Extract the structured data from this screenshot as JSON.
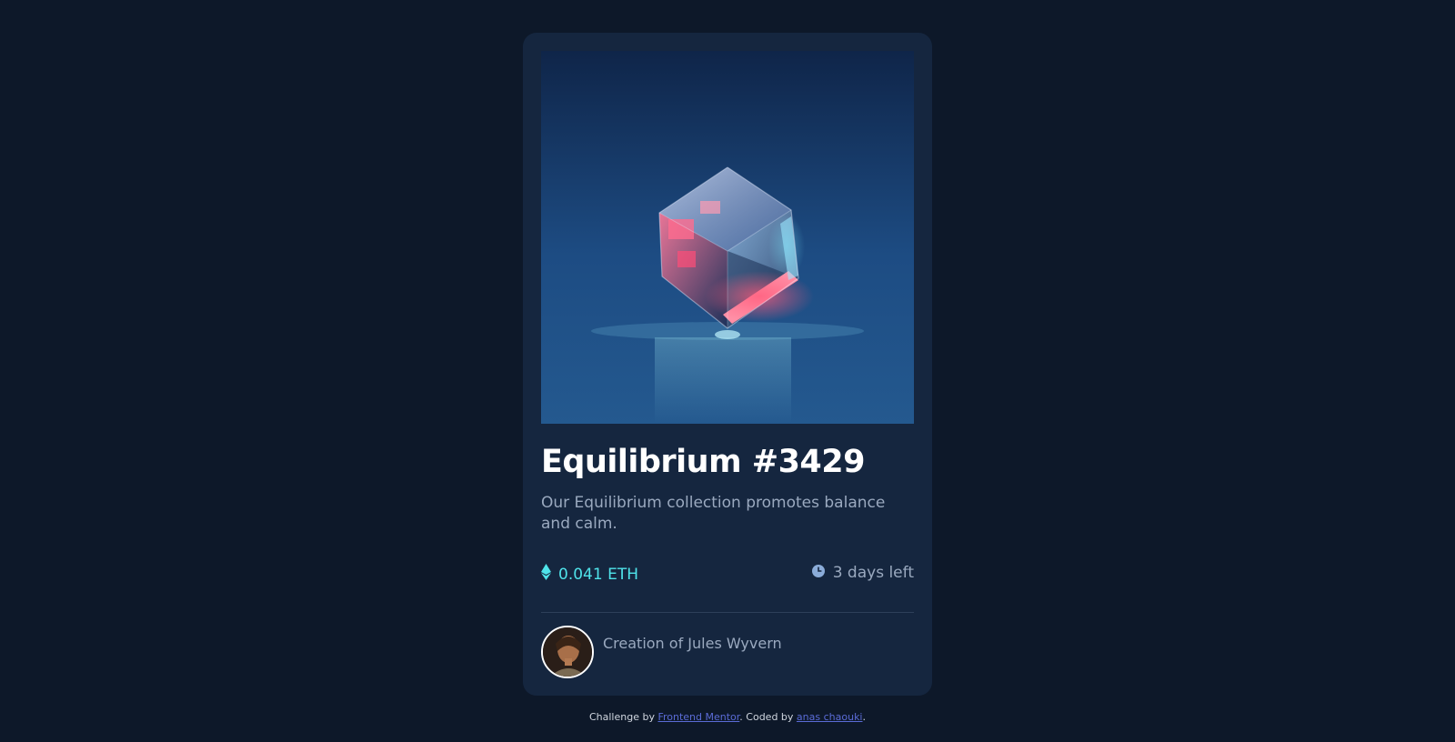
{
  "card": {
    "title": "Equilibrium #3429",
    "description": "Our Equilibrium collection promotes balance and calm.",
    "price": "0.041 ETH",
    "time_left": "3 days left",
    "creator_prefix": "Creation of",
    "creator_name": "Jules Wyvern",
    "hero_image": "equilibrium-cube-image",
    "avatar_image": "jules-wyvern-avatar"
  },
  "icons": {
    "price": "ethereum-icon",
    "time": "clock-icon"
  },
  "attribution": {
    "challenge_prefix": "Challenge by",
    "challenge_link": "Frontend Mentor",
    "coded_prefix": ". Coded by",
    "coded_link": "anas chaouki",
    "suffix": "."
  },
  "colors": {
    "page_background": "#0d1829",
    "card_background": "#15263f",
    "accent_cyan": "#4fe3ea",
    "soft_blue": "#9aa9bf",
    "white": "#ffffff",
    "link": "#5a6bd6"
  }
}
